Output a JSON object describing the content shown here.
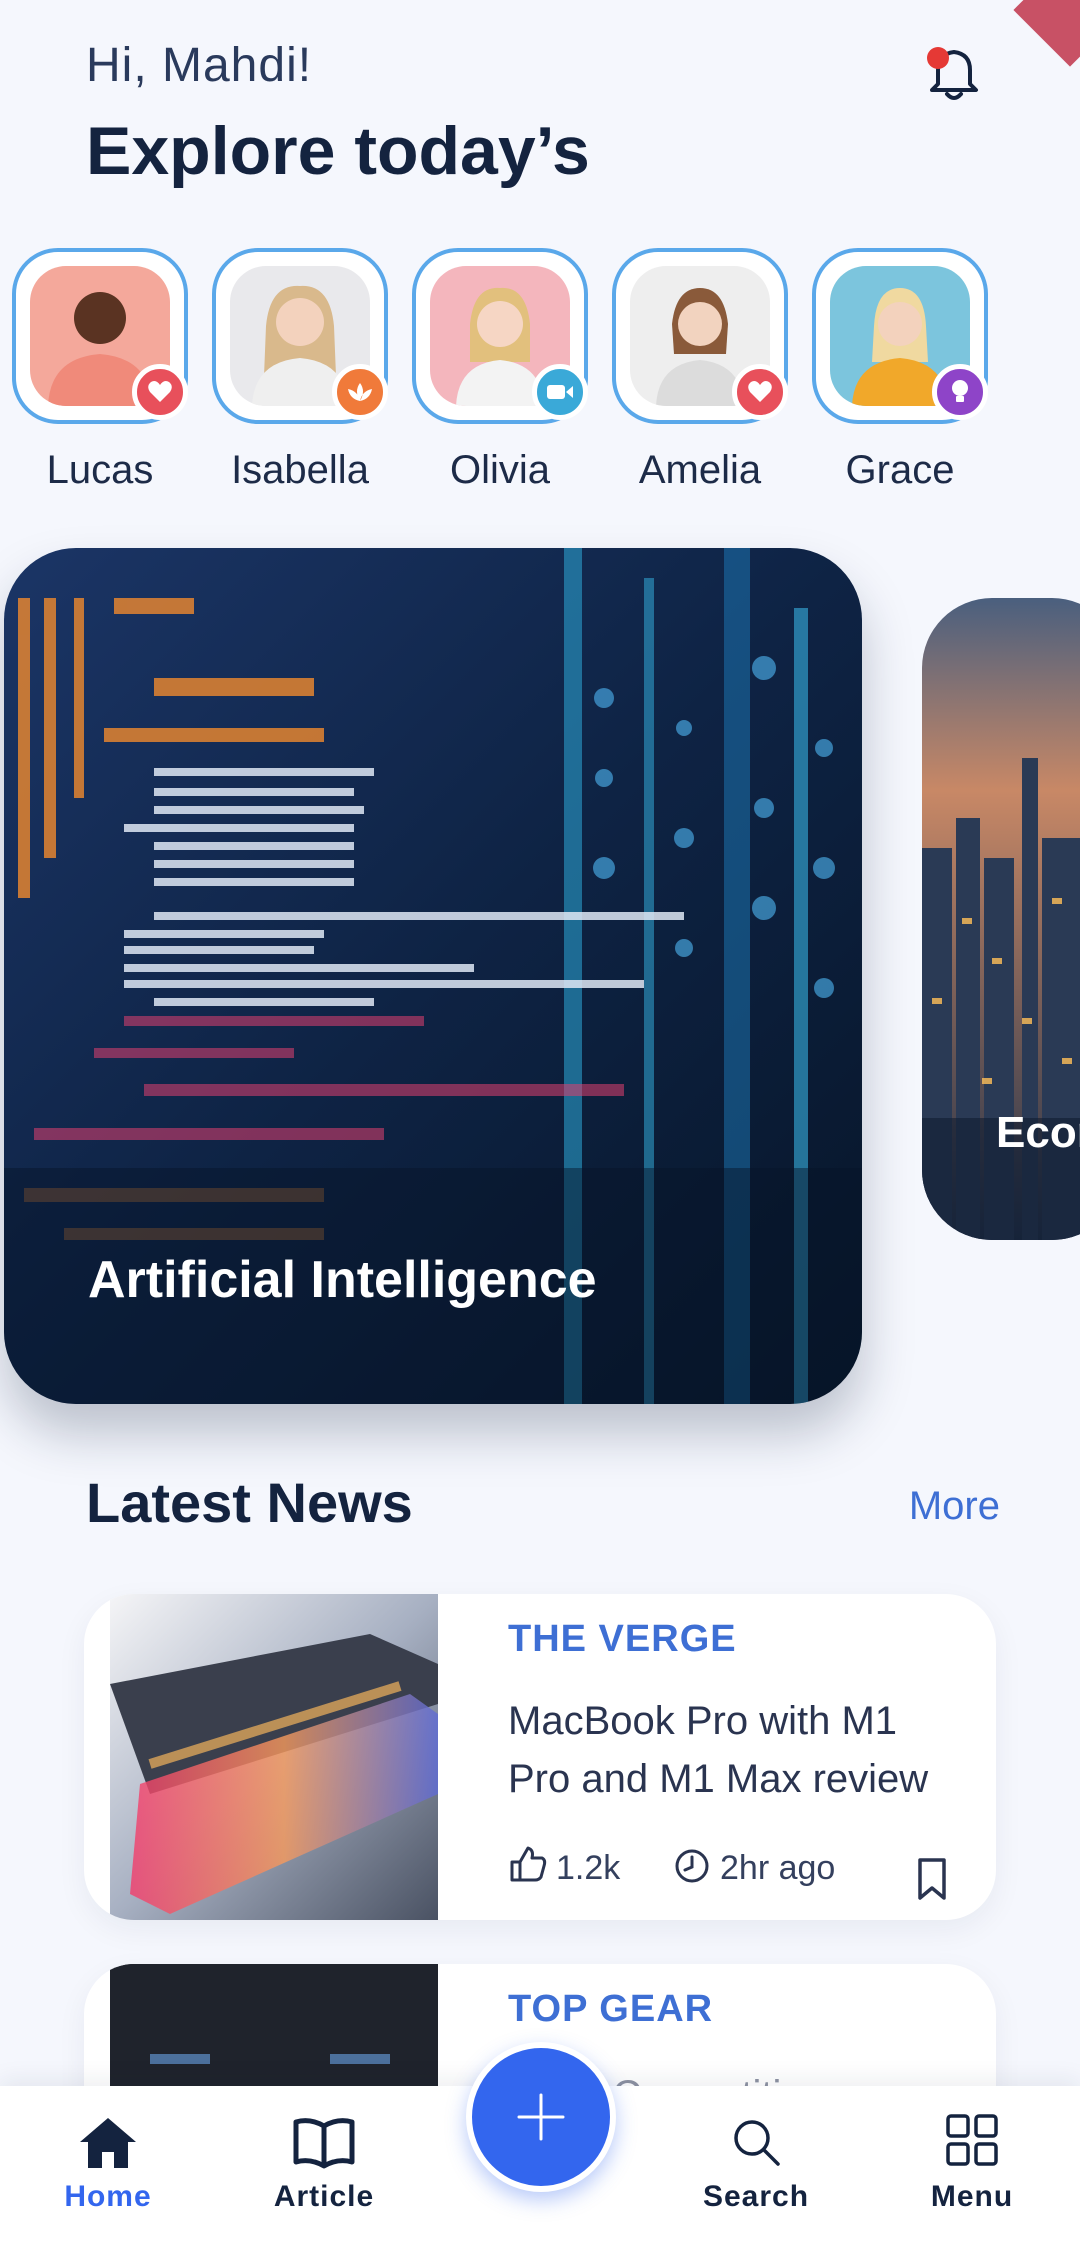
{
  "header": {
    "greeting": "Hi, Mahdi!",
    "title": "Explore today’s"
  },
  "stories": [
    {
      "name": "Lucas",
      "badge_icon": "heart-icon",
      "badge_color": "#e8505b",
      "photo_bg": "#f4a89b",
      "shirt": "#f08a7a"
    },
    {
      "name": "Isabella",
      "badge_icon": "lotus-icon",
      "badge_color": "#f07a3a",
      "photo_bg": "#e9e9ec",
      "shirt": "#efefef"
    },
    {
      "name": "Olivia",
      "badge_icon": "video-icon",
      "badge_color": "#3aa9d8",
      "photo_bg": "#f4b6bd",
      "shirt": "#f3f3f3"
    },
    {
      "name": "Amelia",
      "badge_icon": "heart-icon",
      "badge_color": "#e8505b",
      "photo_bg": "#eeeeee",
      "shirt": "#dcdcdc"
    },
    {
      "name": "Grace",
      "badge_icon": "bulb-icon",
      "badge_color": "#8e44c8",
      "photo_bg": "#7cc5dd",
      "shirt": "#f1a82a"
    }
  ],
  "featured": [
    {
      "label": "Artificial Intelligence"
    },
    {
      "label": "Econ"
    }
  ],
  "latest": {
    "heading": "Latest News",
    "more": "More",
    "items": [
      {
        "source": "THE VERGE",
        "title": "MacBook Pro with M1 Pro and M1 Max review",
        "likes": "1.2k",
        "time": "2hr ago"
      },
      {
        "source": "TOP GEAR",
        "title": "...ME Competition"
      }
    ]
  },
  "nav": {
    "home": "Home",
    "article": "Article",
    "search": "Search",
    "menu": "Menu",
    "fab_icon": "plus-icon",
    "active_color": "#3366ee"
  }
}
